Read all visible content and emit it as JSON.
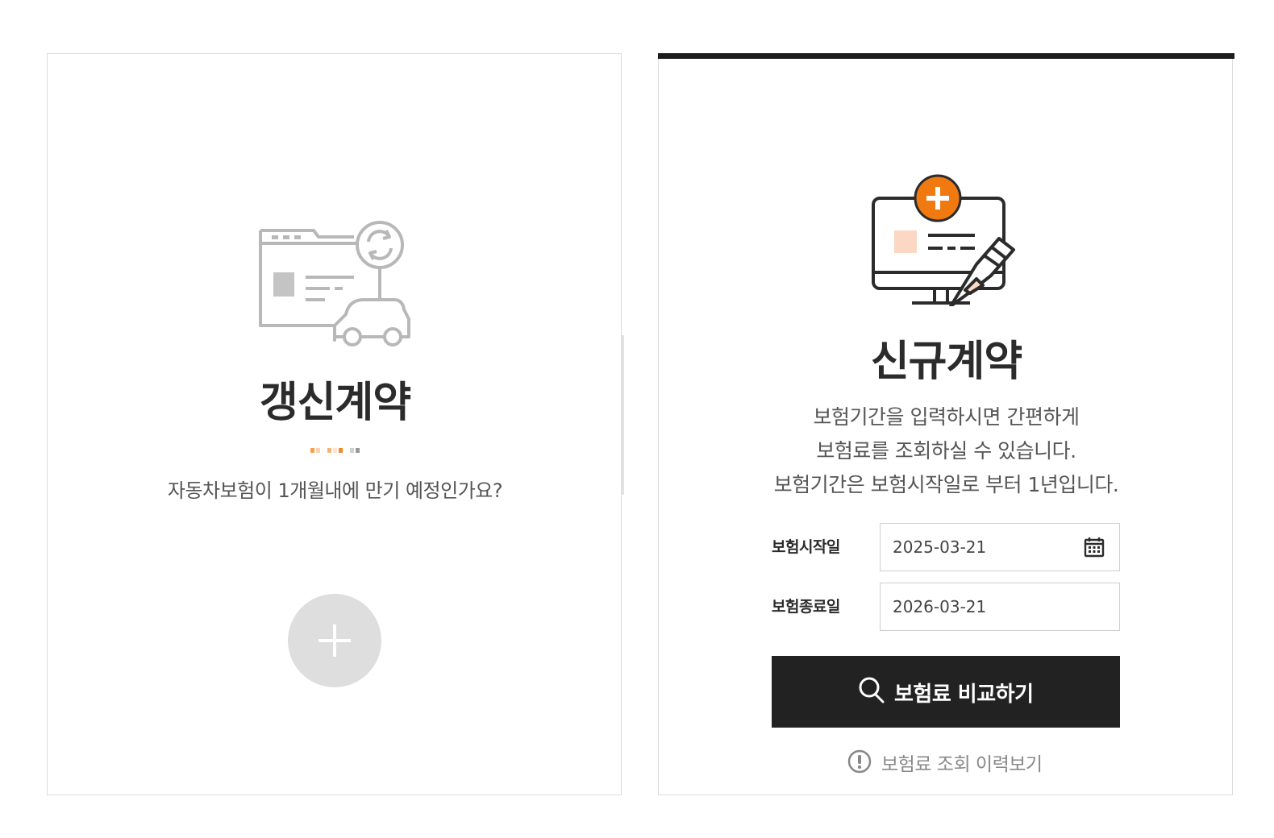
{
  "renew_card": {
    "title": "갱신계약",
    "question": "자동차보험이 1개월내에 만기 예정인가요?",
    "add_icon": "plus-icon"
  },
  "new_card": {
    "title": "신규계약",
    "description": [
      "보험기간을 입력하시면 간편하게",
      "보험료를 조회하실 수 있습니다.",
      "보험기간은 보험시작일로 부터 1년입니다."
    ],
    "start_label": "보험시작일",
    "start_value": "2025-03-21",
    "end_label": "보험종료일",
    "end_value": "2026-03-21",
    "compare_button_label": "보험료 비교하기",
    "history_link_label": "보험료 조회 이력보기"
  },
  "colors": {
    "accent_orange": "#f07a10",
    "button_dark": "#222222",
    "muted_gray": "#dedede",
    "top_bar": "#1c1c1c"
  }
}
